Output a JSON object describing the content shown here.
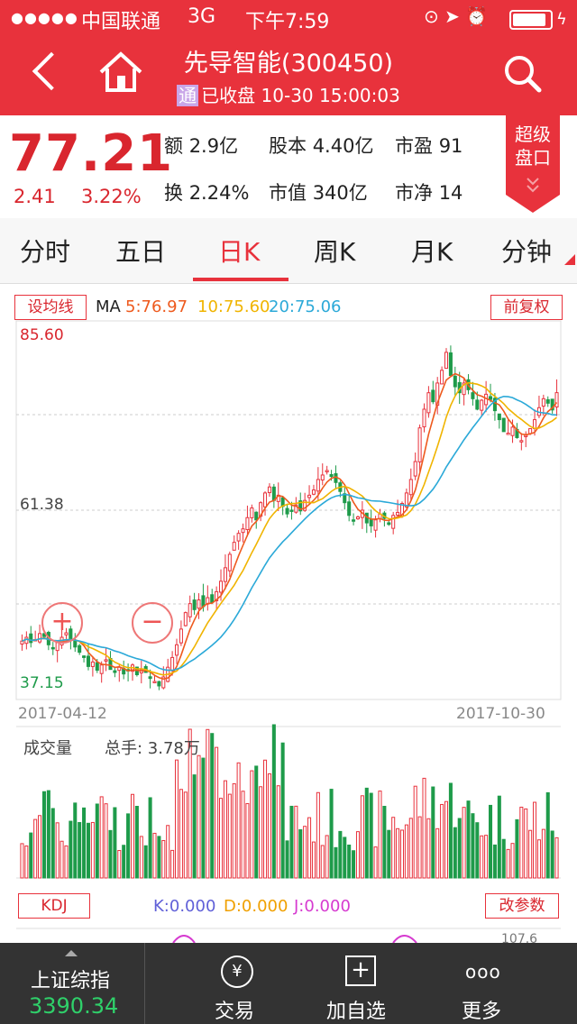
{
  "status": {
    "signal": "●●●●●",
    "carrier": "中国联通",
    "network": "3G",
    "time": "下午7:59"
  },
  "header": {
    "title": "先导智能(300450)",
    "badge": "通",
    "status": "已收盘 10-30 15:00:03"
  },
  "quote": {
    "price": "77.21",
    "change": "2.41",
    "change_pct": "3.22%",
    "stats": [
      {
        "label": "额",
        "value": "2.9亿"
      },
      {
        "label": "股本",
        "value": "4.40亿"
      },
      {
        "label": "市盈",
        "value": "91"
      },
      {
        "label": "换",
        "value": "2.24%"
      },
      {
        "label": "市值",
        "value": "340亿"
      },
      {
        "label": "市净",
        "value": "14"
      }
    ],
    "super_panel": "超级\n盘口"
  },
  "tabs": [
    "分时",
    "五日",
    "日K",
    "周K",
    "月K",
    "分钟"
  ],
  "chart": {
    "set_ma_button": "设均线",
    "ma_prefix": "MA",
    "ma5": "5:76.97",
    "ma10": "10:75.60",
    "ma20": "20:75.06",
    "adjust_button": "前复权",
    "y_high": "85.60",
    "y_mid": "61.38",
    "y_low": "37.15",
    "start_date": "2017-04-12",
    "end_date": "2017-10-30",
    "volume_label": "成交量",
    "total_hands": "总手: 3.78万",
    "kdj_button": "KDJ",
    "k": "K:0.000",
    "d": "D:0.000",
    "j": "J:0.000",
    "params_button": "改参数",
    "kdj_top": "107.6",
    "colors": {
      "up": "#e8323c",
      "down": "#1e9b4a",
      "ma5": "#ee5a1e",
      "ma10": "#f0b400",
      "ma20": "#2ba9d8"
    }
  },
  "chart_data": {
    "type": "candlestick",
    "x_start": "2017-04-12",
    "x_end": "2017-10-30",
    "ylim": [
      37.15,
      85.6
    ],
    "y_ticks": [
      85.6,
      61.38,
      37.15
    ],
    "close": [
      44.0,
      44.5,
      43.8,
      44.2,
      45.0,
      44.6,
      43.5,
      43.0,
      43.8,
      44.5,
      45.1,
      44.3,
      43.2,
      42.5,
      41.8,
      40.6,
      41.2,
      40.1,
      40.8,
      41.5,
      40.2,
      39.8,
      40.5,
      39.6,
      40.0,
      40.8,
      39.5,
      40.2,
      39.8,
      39.0,
      38.6,
      38.0,
      39.2,
      40.5,
      41.8,
      43.5,
      45.6,
      47.8,
      49.0,
      48.2,
      49.5,
      48.6,
      49.8,
      49.2,
      50.6,
      52.0,
      53.8,
      55.6,
      57.2,
      58.4,
      59.0,
      60.5,
      61.8,
      60.2,
      62.5,
      63.8,
      64.6,
      62.8,
      63.5,
      62.0,
      61.0,
      61.5,
      62.2,
      61.4,
      62.8,
      63.5,
      64.2,
      65.6,
      66.2,
      66.8,
      66.0,
      65.2,
      64.0,
      62.5,
      60.8,
      60.2,
      60.6,
      61.5,
      59.8,
      59.4,
      60.2,
      61.0,
      60.4,
      59.6,
      60.8,
      61.2,
      62.4,
      63.8,
      65.6,
      68.0,
      72.5,
      75.0,
      77.2,
      76.0,
      78.5,
      80.2,
      82.6,
      79.5,
      78.0,
      77.2,
      78.5,
      77.6,
      76.4,
      75.0,
      76.2,
      77.0,
      76.3,
      74.8,
      73.6,
      72.0,
      71.8,
      72.6,
      71.2,
      70.8,
      71.5,
      72.4,
      73.6,
      75.2,
      76.4,
      75.8,
      74.9,
      77.21
    ],
    "series": [
      {
        "name": "MA5",
        "last": 76.97
      },
      {
        "name": "MA10",
        "last": 75.6
      },
      {
        "name": "MA20",
        "last": 75.06
      }
    ],
    "volume_series": "成交量"
  },
  "bottom": {
    "index_name": "上证综指",
    "index_value": "3390.34",
    "trade_icon": "¥",
    "trade": "交易",
    "add_icon": "+",
    "add": "加自选",
    "more_icon": "ooo",
    "more": "更多"
  }
}
